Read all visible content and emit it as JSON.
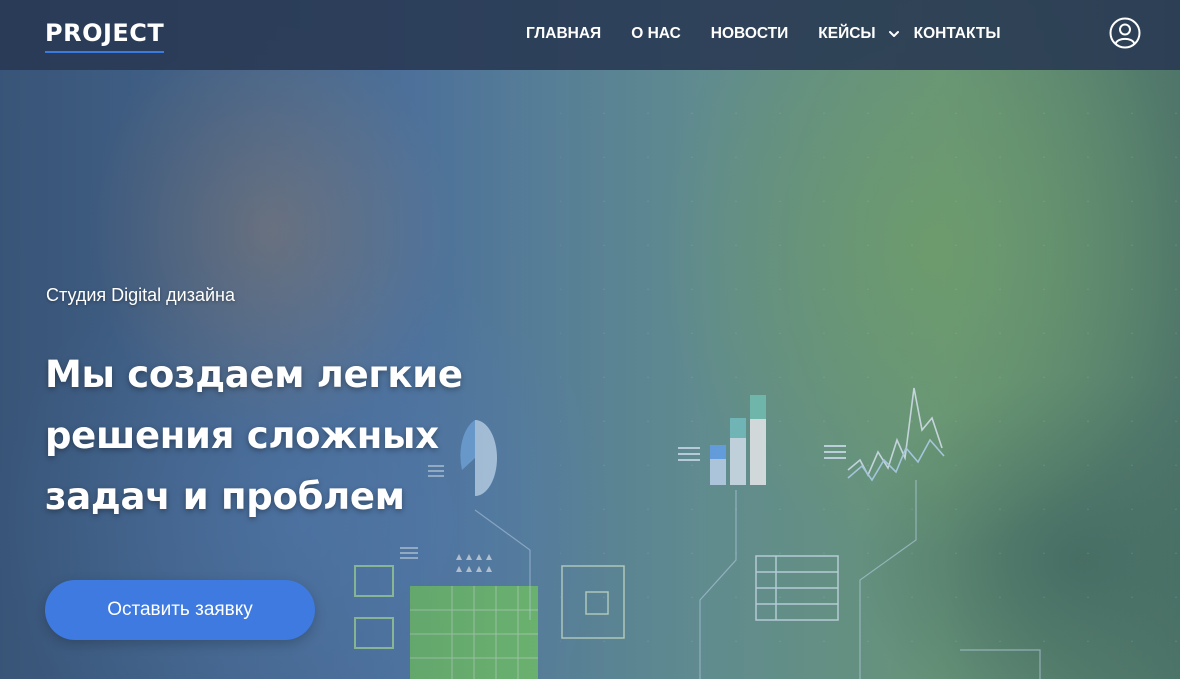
{
  "header": {
    "logo": "PROJECT",
    "nav": [
      {
        "label": "ГЛАВНАЯ"
      },
      {
        "label": "О НАС"
      },
      {
        "label": "НОВОСТИ"
      },
      {
        "label": "КЕЙСЫ",
        "has_dropdown": true
      },
      {
        "label": "КОНТАКТЫ"
      }
    ],
    "user_icon": "user-circle-icon"
  },
  "hero": {
    "subtitle": "Студия Digital дизайна",
    "headline_lines": [
      "Мы создаем легкие",
      "решения сложных",
      "задач и проблем"
    ],
    "cta_label": "Оставить заявку",
    "background_image": "man-with-glasses-digital-graphics"
  },
  "colors": {
    "header_bg": "#283852",
    "accent": "#3f7ae0",
    "text": "#ffffff"
  }
}
